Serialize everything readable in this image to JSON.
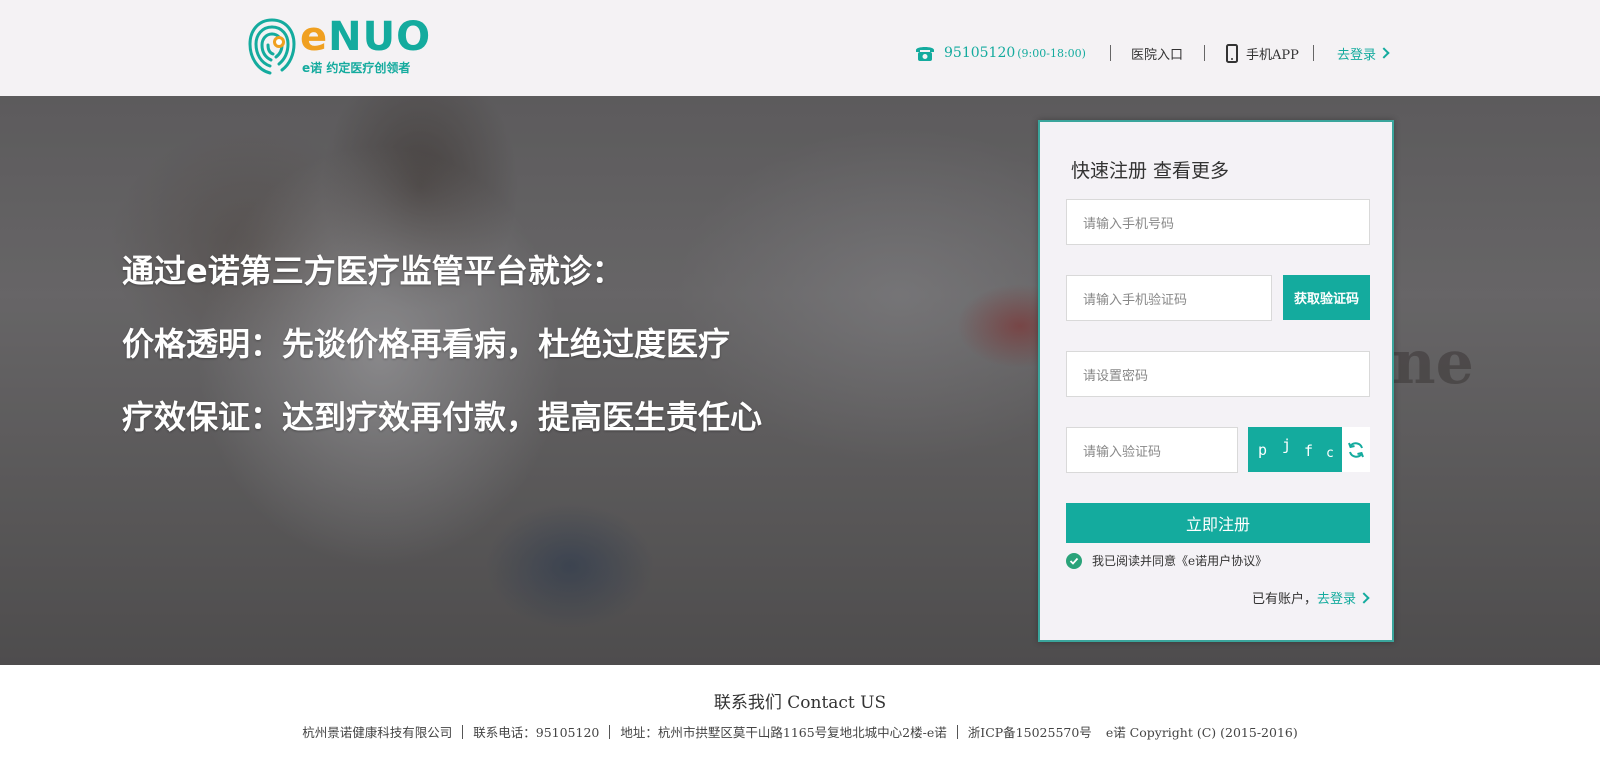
{
  "header": {
    "logo": {
      "word_e": "e",
      "word_rest": "NUO",
      "slogan": "e诺 约定医疗创领者"
    },
    "phone_number": "95105120",
    "phone_hours": "(9:00-18:00)",
    "hospital_entry": "医院入口",
    "mobile_app": "手机APP",
    "login": "去登录",
    "colors": {
      "brand": "#14ab9e",
      "accent": "#f0a020",
      "header_bg": "#f4f2f4"
    }
  },
  "hero": {
    "background_text": "ne",
    "slogans": [
      "通过e诺第三方医疗监管平台就诊：",
      "价格透明：先谈价格再看病，杜绝过度医疗",
      "疗效保证：达到疗效再付款，提高医生责任心"
    ]
  },
  "register": {
    "title": "快速注册  查看更多",
    "phone_placeholder": "请输入手机号码",
    "sms_code_placeholder": "请输入手机验证码",
    "get_code_button": "获取验证码",
    "password_placeholder": "请设置密码",
    "captcha_placeholder": "请输入验证码",
    "captcha_chars": [
      "p",
      "j",
      "f",
      "c"
    ],
    "submit_button": "立即注册",
    "agreement_text": "我已阅读并同意《e诺用户协议》",
    "agreement_checked": true,
    "has_account_text": "已有账户，",
    "login_link": "去登录"
  },
  "icons": {
    "phone": "telephone-icon",
    "mobile": "mobile-phone-icon",
    "login_arrow": "chevron-right-icon",
    "refresh": "refresh-icon",
    "check": "check-circle-icon"
  },
  "footer": {
    "title": "联系我们 Contact US",
    "company": "杭州景诺健康科技有限公司",
    "phone": "联系电话：95105120",
    "address": "地址：杭州市拱墅区莫干山路1165号复地北城中心2楼-e诺",
    "icp": "浙ICP备15025570号",
    "copyright": "e诺 Copyright (C) (2015-2016)"
  }
}
